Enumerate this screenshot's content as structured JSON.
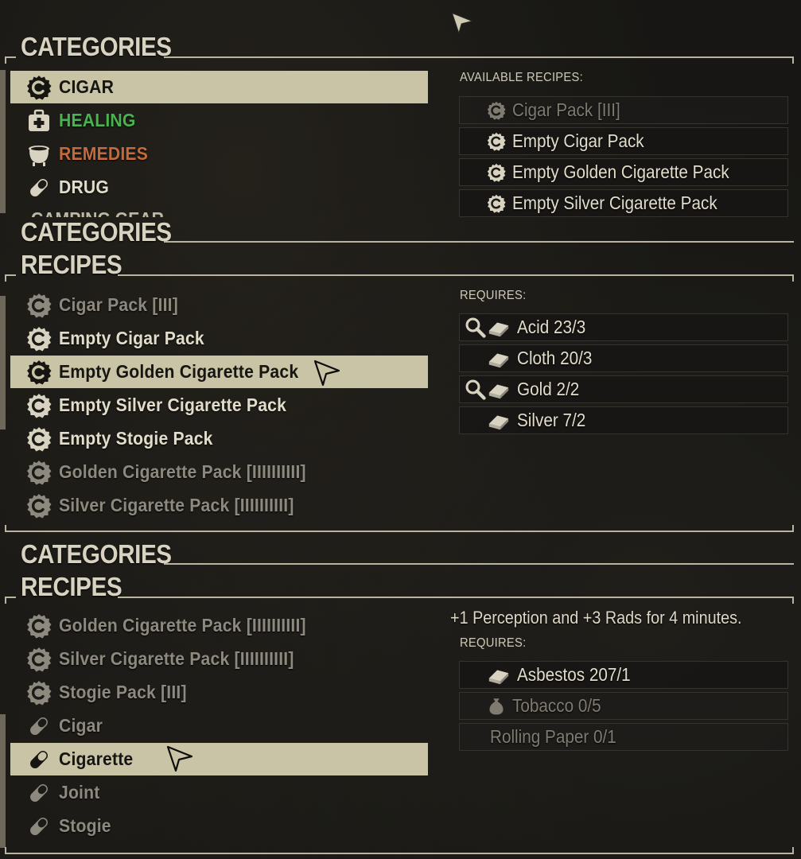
{
  "panel1": {
    "categories_heading": "CATEGORIES",
    "categories": [
      {
        "label": "CIGAR",
        "icon": "cigar-badge-icon",
        "state": "selected"
      },
      {
        "label": "HEALING",
        "icon": "medkit-icon",
        "color": "#49b34e"
      },
      {
        "label": "REMEDIES",
        "icon": "cauldron-icon",
        "color": "#c36a3a"
      },
      {
        "label": "DRUG",
        "icon": "pill-icon"
      }
    ],
    "clipped_category": "CAMPING GEAR",
    "available_label": "AVAILABLE RECIPES:",
    "available_recipes": [
      {
        "label": "Cigar Pack [III]",
        "state": "dim"
      },
      {
        "label": "Empty Cigar Pack"
      },
      {
        "label": "Empty Golden Cigarette Pack"
      },
      {
        "label": "Empty Silver Cigarette Pack"
      }
    ]
  },
  "panel2": {
    "categories_heading": "CATEGORIES",
    "recipes_heading": "RECIPES",
    "recipes": [
      {
        "label": "Cigar Pack [III]",
        "state": "dim"
      },
      {
        "label": "Empty Cigar Pack"
      },
      {
        "label": "Empty Golden Cigarette Pack",
        "state": "selected"
      },
      {
        "label": "Empty Silver Cigarette Pack"
      },
      {
        "label": "Empty Stogie Pack"
      },
      {
        "label": "Golden Cigarette Pack [IIIIIIIIII]",
        "state": "dim"
      },
      {
        "label": "Silver Cigarette Pack [IIIIIIIIII]",
        "state": "dim"
      }
    ],
    "requires_label": "REQUIRES:",
    "requirements": [
      {
        "label": "Acid 23/3",
        "search": true
      },
      {
        "label": "Cloth 20/3",
        "search": false
      },
      {
        "label": "Gold 2/2",
        "search": true
      },
      {
        "label": "Silver 7/2",
        "search": false
      }
    ]
  },
  "panel3": {
    "categories_heading": "CATEGORIES",
    "recipes_heading": "RECIPES",
    "recipes": [
      {
        "label": "Golden Cigarette Pack [IIIIIIIIII]",
        "icon": "cigar-badge-icon",
        "state": "dim"
      },
      {
        "label": "Silver Cigarette Pack [IIIIIIIIII]",
        "icon": "cigar-badge-icon",
        "state": "dim"
      },
      {
        "label": "Stogie Pack [III]",
        "icon": "cigar-badge-icon",
        "state": "dim"
      },
      {
        "label": "Cigar",
        "icon": "pill-icon",
        "state": "dim"
      },
      {
        "label": "Cigarette",
        "icon": "pill-icon",
        "state": "selected"
      },
      {
        "label": "Joint",
        "icon": "pill-icon",
        "state": "dim"
      },
      {
        "label": "Stogie",
        "icon": "pill-icon",
        "state": "dim"
      }
    ],
    "description": "+1 Perception and +3 Rads for 4 minutes.",
    "requires_label": "REQUIRES:",
    "requirements": [
      {
        "label": "Asbestos 207/1",
        "icon": "junk-bar-icon"
      },
      {
        "label": "Tobacco 0/5",
        "icon": "sack-icon",
        "state": "dim"
      },
      {
        "label": "Rolling Paper 0/1",
        "icon": "none",
        "state": "dim"
      }
    ]
  },
  "colors": {
    "selected_bg": "#c9c4a6",
    "text": "#e2dccb",
    "dim_text": "#8d897f",
    "healing": "#49b34e",
    "remedies": "#c36a3a",
    "frame": "#b9b39f"
  }
}
